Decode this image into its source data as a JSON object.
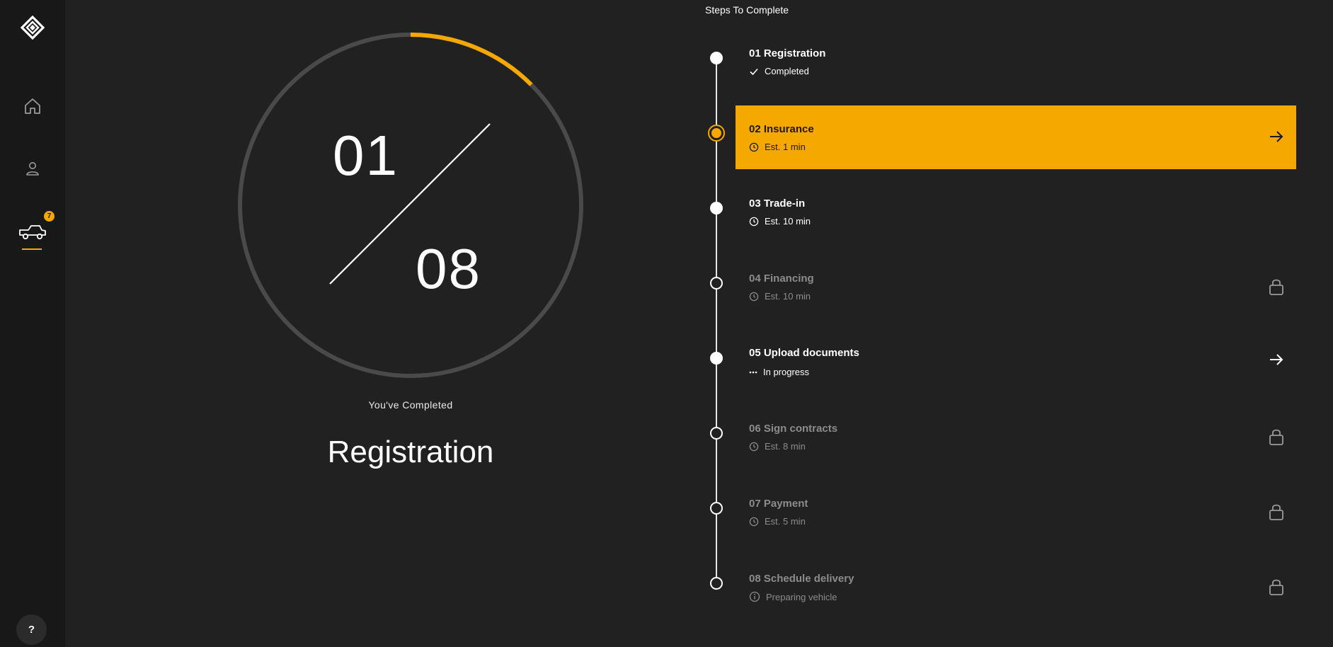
{
  "sidebar": {
    "badge_count": "7",
    "help_label": "?"
  },
  "progress": {
    "current": "01",
    "total": "08",
    "fraction": 0.125,
    "caption": "You've Completed",
    "completed_step": "Registration"
  },
  "steps_title": "Steps To Complete",
  "steps": [
    {
      "title": "01 Registration",
      "sub": "Completed",
      "status": "completed",
      "sub_icon": "check-icon"
    },
    {
      "title": "02 Insurance",
      "sub": "Est. 1 min",
      "status": "current",
      "sub_icon": "clock-icon",
      "action": "arrow-right-icon"
    },
    {
      "title": "03 Trade-in",
      "sub": "Est. 10 min",
      "status": "available",
      "sub_icon": "clock-icon"
    },
    {
      "title": "04 Financing",
      "sub": "Est. 10 min",
      "status": "locked",
      "sub_icon": "clock-icon",
      "action": "lock-icon"
    },
    {
      "title": "05 Upload documents",
      "sub": "In progress",
      "status": "in-progress",
      "sub_icon": "ellipsis-icon",
      "action": "arrow-right-icon"
    },
    {
      "title": "06 Sign contracts",
      "sub": "Est. 8 min",
      "status": "locked",
      "sub_icon": "clock-icon",
      "action": "lock-icon"
    },
    {
      "title": "07 Payment",
      "sub": "Est. 5 min",
      "status": "locked",
      "sub_icon": "clock-icon",
      "action": "lock-icon"
    },
    {
      "title": "08 Schedule delivery",
      "sub": "Preparing vehicle",
      "status": "locked",
      "sub_icon": "info-icon",
      "action": "lock-icon"
    }
  ],
  "colors": {
    "accent": "#f5a800",
    "background": "#212121",
    "sidebar": "#181818",
    "locked_text": "#8c8c8c"
  }
}
